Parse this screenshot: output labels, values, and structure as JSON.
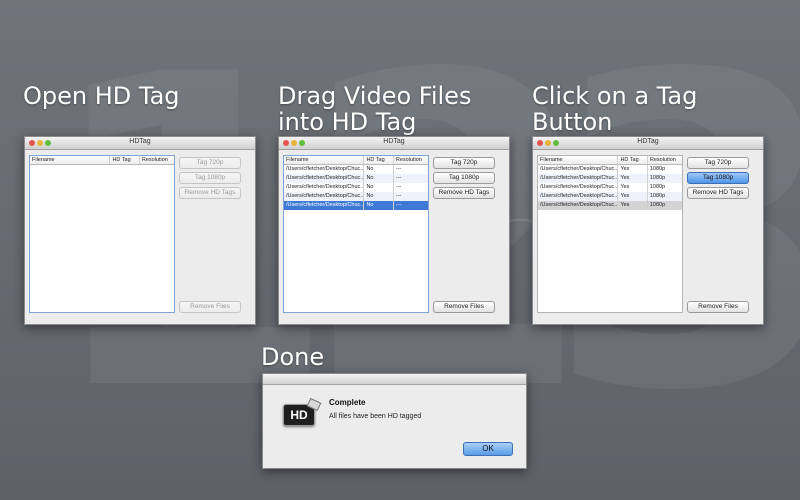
{
  "steps": [
    {
      "title": "Open HD Tag"
    },
    {
      "title": "Drag Video Files\ninto HD Tag"
    },
    {
      "title": "Click on a Tag\nButton"
    },
    {
      "title": "Done"
    }
  ],
  "background_digits": [
    "1",
    "2",
    "3"
  ],
  "window_title": "HDTag",
  "columns": [
    "Filename",
    "HD Tag",
    "Resolution"
  ],
  "buttons": {
    "tag720": "Tag 720p",
    "tag1080": "Tag 1080p",
    "remove_tags": "Remove HD Tags",
    "remove_files": "Remove Files"
  },
  "window2_rows": [
    {
      "filename": "/Users/cfletcher/Desktop/Chuc...",
      "hd": "No",
      "res": "---"
    },
    {
      "filename": "/Users/cfletcher/Desktop/Chuc...",
      "hd": "No",
      "res": "---"
    },
    {
      "filename": "/Users/cfletcher/Desktop/Chuc...",
      "hd": "No",
      "res": "---"
    },
    {
      "filename": "/Users/cfletcher/Desktop/Chuc...",
      "hd": "No",
      "res": "---"
    },
    {
      "filename": "/Users/cfletcher/Desktop/Chuc...",
      "hd": "No",
      "res": "---"
    }
  ],
  "window3_rows": [
    {
      "filename": "/Users/cfletcher/Desktop/Chuc...",
      "hd": "Yes",
      "res": "1080p"
    },
    {
      "filename": "/Users/cfletcher/Desktop/Chuc...",
      "hd": "Yes",
      "res": "1080p"
    },
    {
      "filename": "/Users/cfletcher/Desktop/Chuc...",
      "hd": "Yes",
      "res": "1080p"
    },
    {
      "filename": "/Users/cfletcher/Desktop/Chuc...",
      "hd": "Yes",
      "res": "1080p"
    },
    {
      "filename": "/Users/cfletcher/Desktop/Chuc...",
      "hd": "Yes",
      "res": "1080p"
    }
  ],
  "dialog": {
    "icon_text": "HD",
    "title": "Complete",
    "message": "All files have been HD tagged",
    "ok": "OK"
  }
}
